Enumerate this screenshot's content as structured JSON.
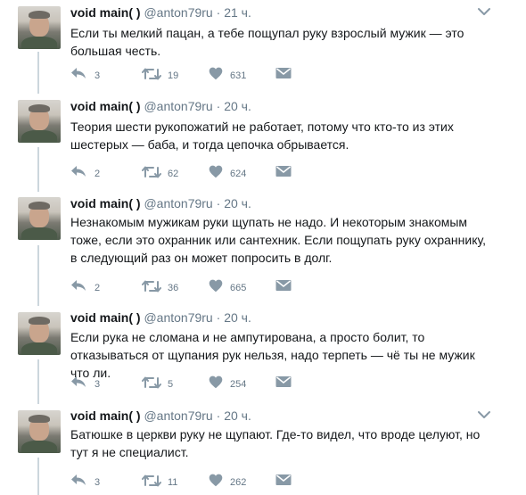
{
  "colors": {
    "text": "#14171a",
    "muted": "#657786",
    "icon": "#8899a6",
    "thread_line": "#ccd6dd"
  },
  "tweets": [
    {
      "name": "void main( )",
      "handle": "@anton79ru",
      "dot": "·",
      "time": "21 ч.",
      "text": "Если ты мелкий пацан, а тебе пощупал руку взрослый мужик — это большая честь.",
      "replies": "3",
      "retweets": "19",
      "likes": "631"
    },
    {
      "name": "void main( )",
      "handle": "@anton79ru",
      "dot": "·",
      "time": "20 ч.",
      "text": "Теория шести рукопожатий не работает, потому что кто-то из этих шестерых — баба, и тогда цепочка обрывается.",
      "replies": "2",
      "retweets": "62",
      "likes": "624"
    },
    {
      "name": "void main( )",
      "handle": "@anton79ru",
      "dot": "·",
      "time": "20 ч.",
      "text": "Незнакомым мужикам руки щупать не надо. И некоторым знакомым тоже, если это охранник или сантехник. Если пощупать руку охраннику, в следующий раз он может попросить в долг.",
      "replies": "2",
      "retweets": "36",
      "likes": "665"
    },
    {
      "name": "void main( )",
      "handle": "@anton79ru",
      "dot": "·",
      "time": "20 ч.",
      "text": "Если рука не сломана и не ампутирована, а просто болит, то отказываться от щупания рук нельзя, надо терпеть — чё ты не мужик что ли.",
      "replies": "3",
      "retweets": "5",
      "likes": "254"
    },
    {
      "name": "void main( )",
      "handle": "@anton79ru",
      "dot": "·",
      "time": "20 ч.",
      "text": "Батюшке в церкви руку не щупают. Где-то видел, что вроде целуют, но тут я не специалист.",
      "replies": "3",
      "retweets": "11",
      "likes": "262"
    }
  ]
}
